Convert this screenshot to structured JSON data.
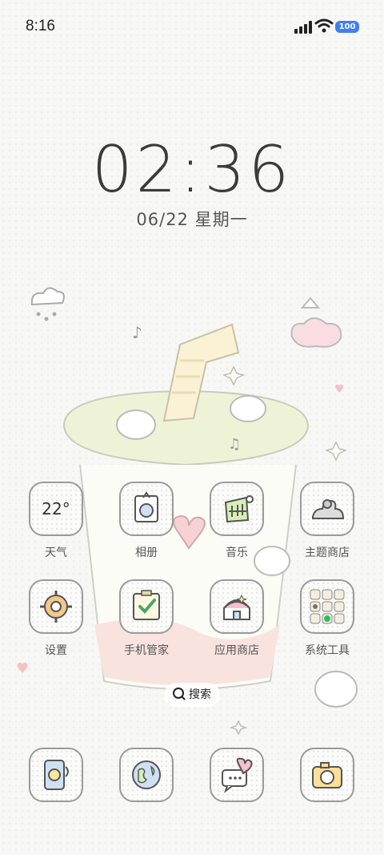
{
  "status_bar": {
    "time": "8:16",
    "battery": "100"
  },
  "lock": {
    "time": "02:36",
    "time_h": "02",
    "time_m": "36",
    "date": "06/22 星期一"
  },
  "apps": [
    {
      "label": "天气",
      "icon": "weather-icon",
      "temp": "22°"
    },
    {
      "label": "相册",
      "icon": "gallery-icon"
    },
    {
      "label": "音乐",
      "icon": "music-icon"
    },
    {
      "label": "主题商店",
      "icon": "theme-store-icon"
    },
    {
      "label": "设置",
      "icon": "settings-icon"
    },
    {
      "label": "手机管家",
      "icon": "phone-manager-icon"
    },
    {
      "label": "应用商店",
      "icon": "app-store-icon"
    },
    {
      "label": "系统工具",
      "icon": "system-tools-folder-icon"
    }
  ],
  "search": {
    "label": "搜索"
  },
  "dock": [
    {
      "icon": "phone-icon"
    },
    {
      "icon": "browser-icon"
    },
    {
      "icon": "messages-icon"
    },
    {
      "icon": "camera-icon"
    }
  ],
  "colors": {
    "accent": "#3f7ff1",
    "cup": "#eef3d8",
    "pink": "#f4c4c6"
  }
}
